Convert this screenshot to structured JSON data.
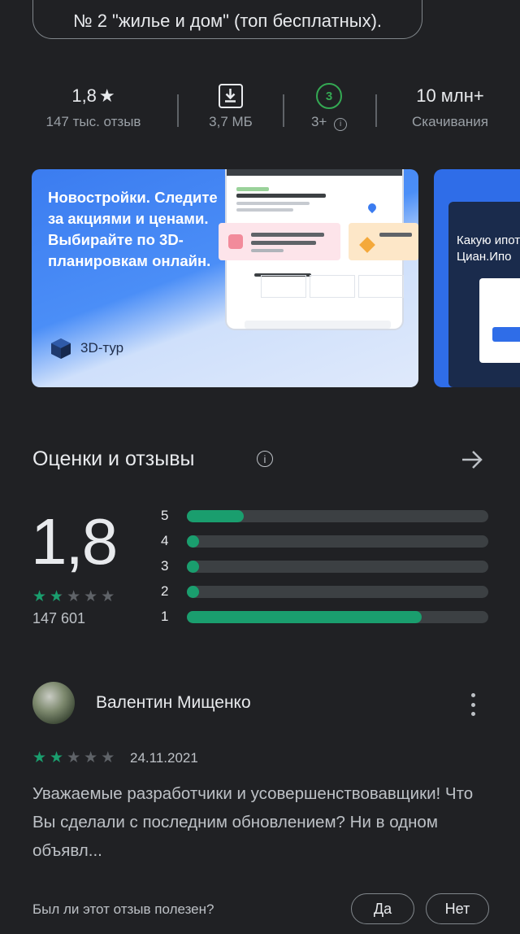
{
  "category_chip": "№ 2 \"жилье и дом\" (топ бесплатных).",
  "stats": {
    "rating_value": "1,8",
    "rating_star": "★",
    "reviews_label": "147 тыс. отзыв",
    "size_value": "3,7 МБ",
    "age_badge": "3",
    "age_label": "3+",
    "age_info": "i",
    "downloads_value": "10 млн+",
    "downloads_label": "Скачивания"
  },
  "screenshots": {
    "first": {
      "promo_text": "Новостройки. Следите за акциями и ценами. Выбирайте по 3D-планировкам онлайн.",
      "tour_label": "3D-тур"
    },
    "second": {
      "promo_text": "Какую ипоте Циан.Ипо"
    }
  },
  "ratings_section": {
    "title": "Оценки и отзывы",
    "info": "i",
    "average": "1,8",
    "average_stars": 1.8,
    "total_count": "147 601",
    "distribution": [
      {
        "stars": "5",
        "fraction": 0.19
      },
      {
        "stars": "4",
        "fraction": 0.04
      },
      {
        "stars": "3",
        "fraction": 0.04
      },
      {
        "stars": "2",
        "fraction": 0.04
      },
      {
        "stars": "1",
        "fraction": 0.78
      }
    ]
  },
  "review": {
    "author": "Валентин Мищенко",
    "stars": 2,
    "date": "24.11.2021",
    "text": "Уважаемые разработчики и усовершенствовавщики! Что Вы сделали с последним обновлением? Ни в одном объявл...",
    "helpful_question": "Был ли этот отзыв полезен?",
    "yes_label": "Да",
    "no_label": "Нет"
  },
  "colors": {
    "accent_green": "#1a9e6e",
    "age_green": "#34a853",
    "star_empty": "#5f6368",
    "background": "#202124"
  }
}
